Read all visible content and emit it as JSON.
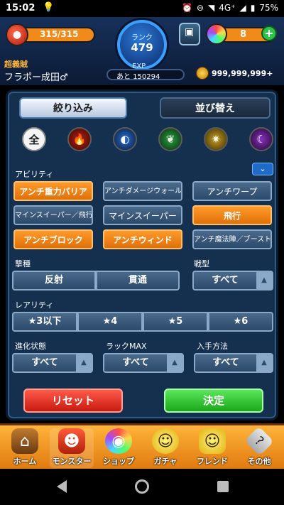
{
  "status_bar": {
    "time": "15:02",
    "network": "4G⁺",
    "battery": "75%"
  },
  "header": {
    "stamina": "315/315",
    "rank_label": "ランク",
    "rank_value": "479",
    "exp_label": "EXP",
    "exp_remaining": "あと 150294",
    "orb_count": "8",
    "plus_label": "+",
    "player_title": "超義賊",
    "player_name": "フラポー成田♂",
    "coins": "999,999,999+"
  },
  "tabs": {
    "filter": "絞り込み",
    "sort": "並び替え"
  },
  "attributes": {
    "all_label": "全",
    "items": [
      "all",
      "fire",
      "water",
      "wood",
      "light",
      "dark"
    ]
  },
  "ability": {
    "label": "アビリティ",
    "chips": [
      {
        "label": "アンチ重力バリア",
        "selected": true
      },
      {
        "label": "アンチダメージウォール",
        "selected": false
      },
      {
        "label": "アンチワープ",
        "selected": false
      },
      {
        "label": "マインスイーパー／飛行",
        "selected": false
      },
      {
        "label": "マインスイーパー",
        "selected": false
      },
      {
        "label": "飛行",
        "selected": true
      },
      {
        "label": "アンチブロック",
        "selected": true
      },
      {
        "label": "アンチウィンド",
        "selected": true
      },
      {
        "label": "アンチ魔法陣／ブースト",
        "selected": false
      }
    ]
  },
  "attack_type": {
    "label": "撃種",
    "options": [
      "反射",
      "貫通"
    ]
  },
  "battle_type": {
    "label": "戦型",
    "value": "すべて"
  },
  "rarity": {
    "label": "レアリティ",
    "options": [
      "★3以下",
      "★4",
      "★5",
      "★6"
    ]
  },
  "evolution": {
    "label": "進化状態",
    "value": "すべて"
  },
  "luck_max": {
    "label": "ラックMAX",
    "value": "すべて"
  },
  "acquire": {
    "label": "入手方法",
    "value": "すべて"
  },
  "buttons": {
    "reset": "リセット",
    "confirm": "決定"
  },
  "bottom_nav": [
    {
      "label": "ホーム",
      "icon": "house-icon",
      "glyph": "⌂"
    },
    {
      "label": "モンスター",
      "icon": "monster-icon",
      "glyph": "☻"
    },
    {
      "label": "ショップ",
      "icon": "orb-icon",
      "glyph": "◉"
    },
    {
      "label": "ガチャ",
      "icon": "gacha-icon",
      "glyph": "☺"
    },
    {
      "label": "フレンド",
      "icon": "friend-icon",
      "glyph": "☺"
    },
    {
      "label": "その他",
      "icon": "other-icon",
      "glyph": "?"
    }
  ],
  "colors": {
    "selected_chip": "#ff9a2a",
    "unselected_chip": "#4a6a8c",
    "reset": "#e0301a",
    "confirm": "#2ec24a"
  }
}
